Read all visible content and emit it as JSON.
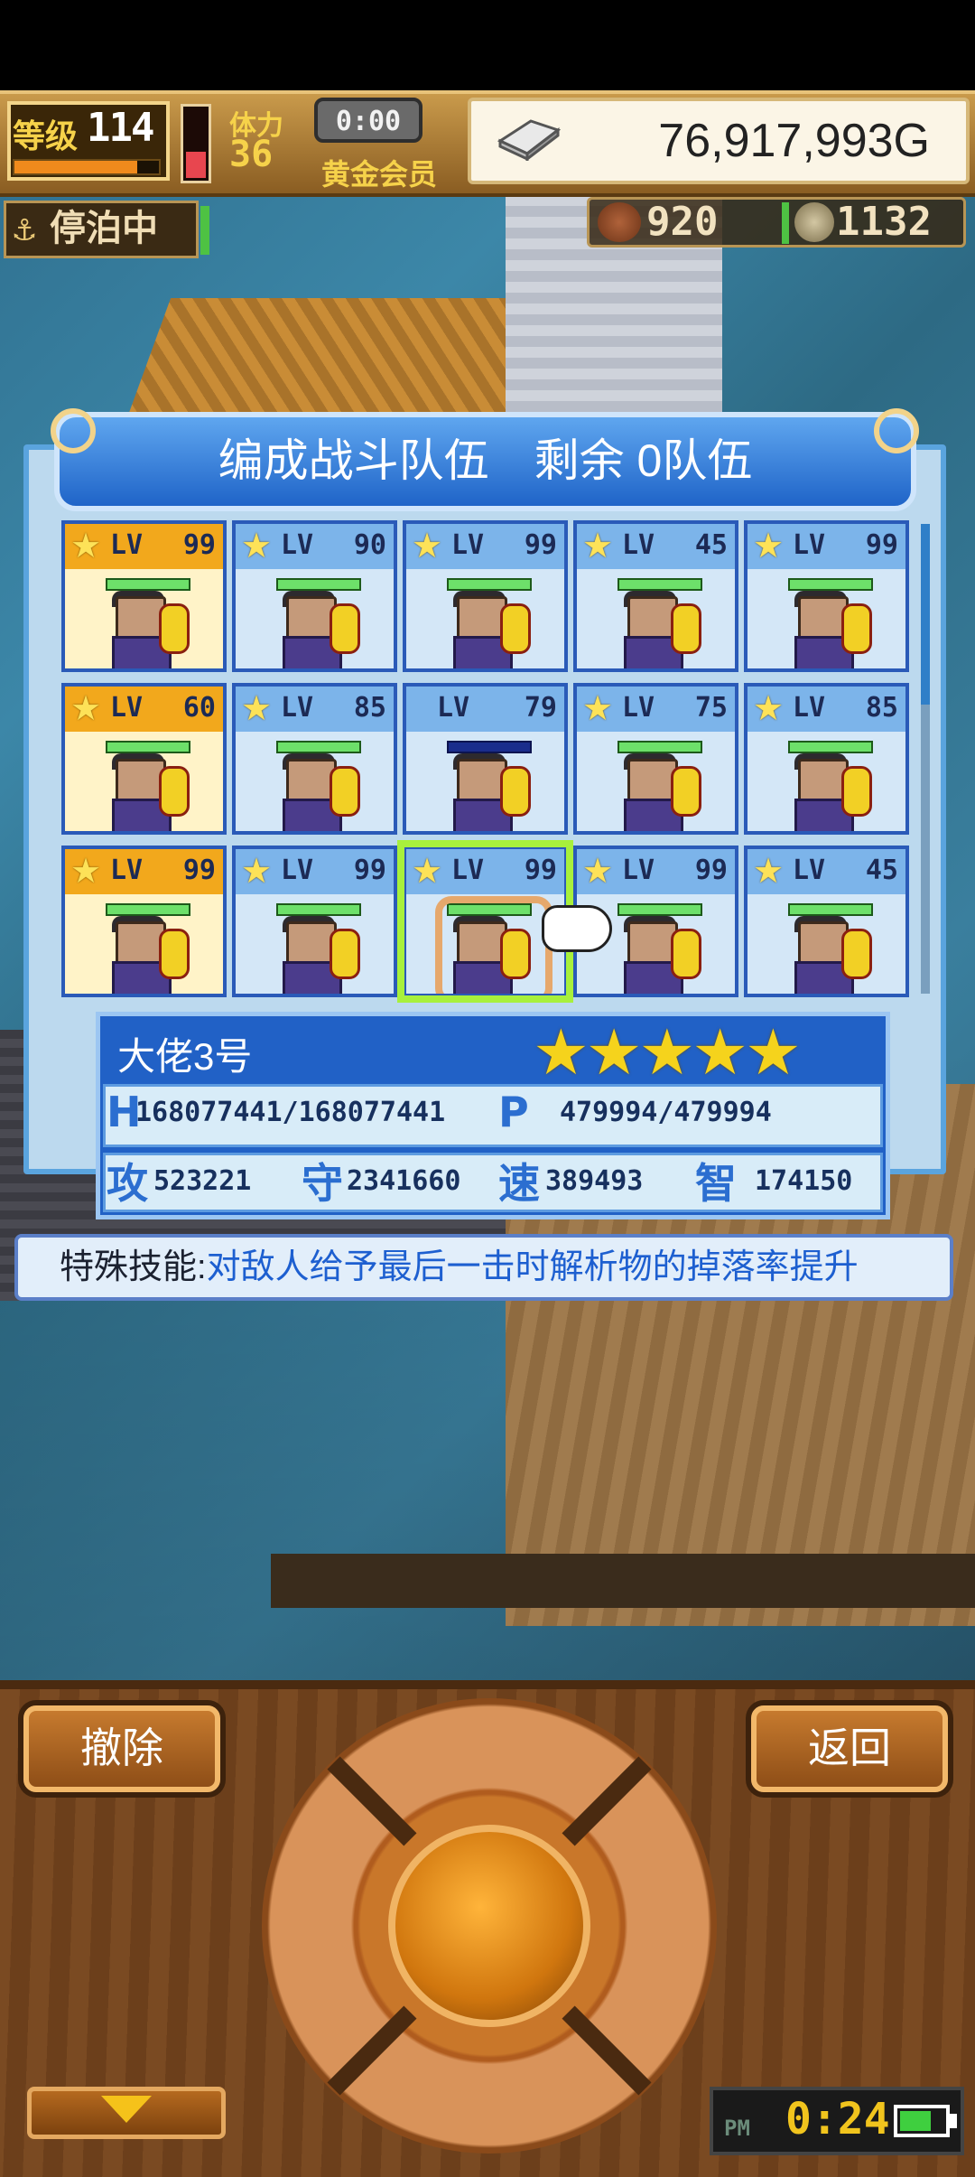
{
  "status": {
    "level_label": "等级",
    "level_value": "114",
    "level_progress": 0.85,
    "stamina_label": "体力",
    "stamina_value": "36",
    "stamina_level": 0.35,
    "timer": "0:00",
    "membership": "黄金会员",
    "gold": "76,917,993G",
    "docked_label": "停泊中",
    "wood": "920",
    "ore": "1132"
  },
  "dialog": {
    "title": "编成战斗队伍　剩余 0队伍",
    "lv_text": "LV",
    "cards": [
      {
        "lv": "99",
        "style": "gold",
        "star": true
      },
      {
        "lv": "90",
        "style": "blue",
        "star": true
      },
      {
        "lv": "99",
        "style": "blue",
        "star": true
      },
      {
        "lv": "45",
        "style": "blue",
        "star": true
      },
      {
        "lv": "99",
        "style": "blue",
        "star": true
      },
      {
        "lv": "60",
        "style": "gold",
        "star": true
      },
      {
        "lv": "85",
        "style": "blue",
        "star": true
      },
      {
        "lv": "79",
        "style": "blue",
        "star": false
      },
      {
        "lv": "75",
        "style": "blue",
        "star": true
      },
      {
        "lv": "85",
        "style": "blue",
        "star": true
      },
      {
        "lv": "99",
        "style": "gold",
        "star": true
      },
      {
        "lv": "99",
        "style": "blue",
        "star": true
      },
      {
        "lv": "99",
        "style": "blue",
        "star": true,
        "selected": true
      },
      {
        "lv": "99",
        "style": "blue",
        "star": true
      },
      {
        "lv": "45",
        "style": "blue",
        "star": true
      }
    ]
  },
  "info": {
    "name": "大佬3号",
    "rating": 5,
    "rating_text": "★★★★★",
    "hp_text": "168077441/168077441",
    "mp_text": "479994/479994",
    "attack_tag": "攻",
    "attack_value": "523221",
    "defense_tag": "守",
    "defense_value": "2341660",
    "speed_tag": "速",
    "speed_value": "389493",
    "intel_tag": "智",
    "intel_value": "174150"
  },
  "skill": {
    "label": "特殊技能:",
    "text": "对敌人给予最后一击时解析物的掉落率提升"
  },
  "controls": {
    "remove_label": "撤除",
    "back_label": "返回",
    "clock_ampm": "PM",
    "clock_time": "0:24"
  },
  "colors": {
    "accent_blue": "#2161c6",
    "gold_card": "#f2a81c",
    "selection": "#a8f03c"
  }
}
